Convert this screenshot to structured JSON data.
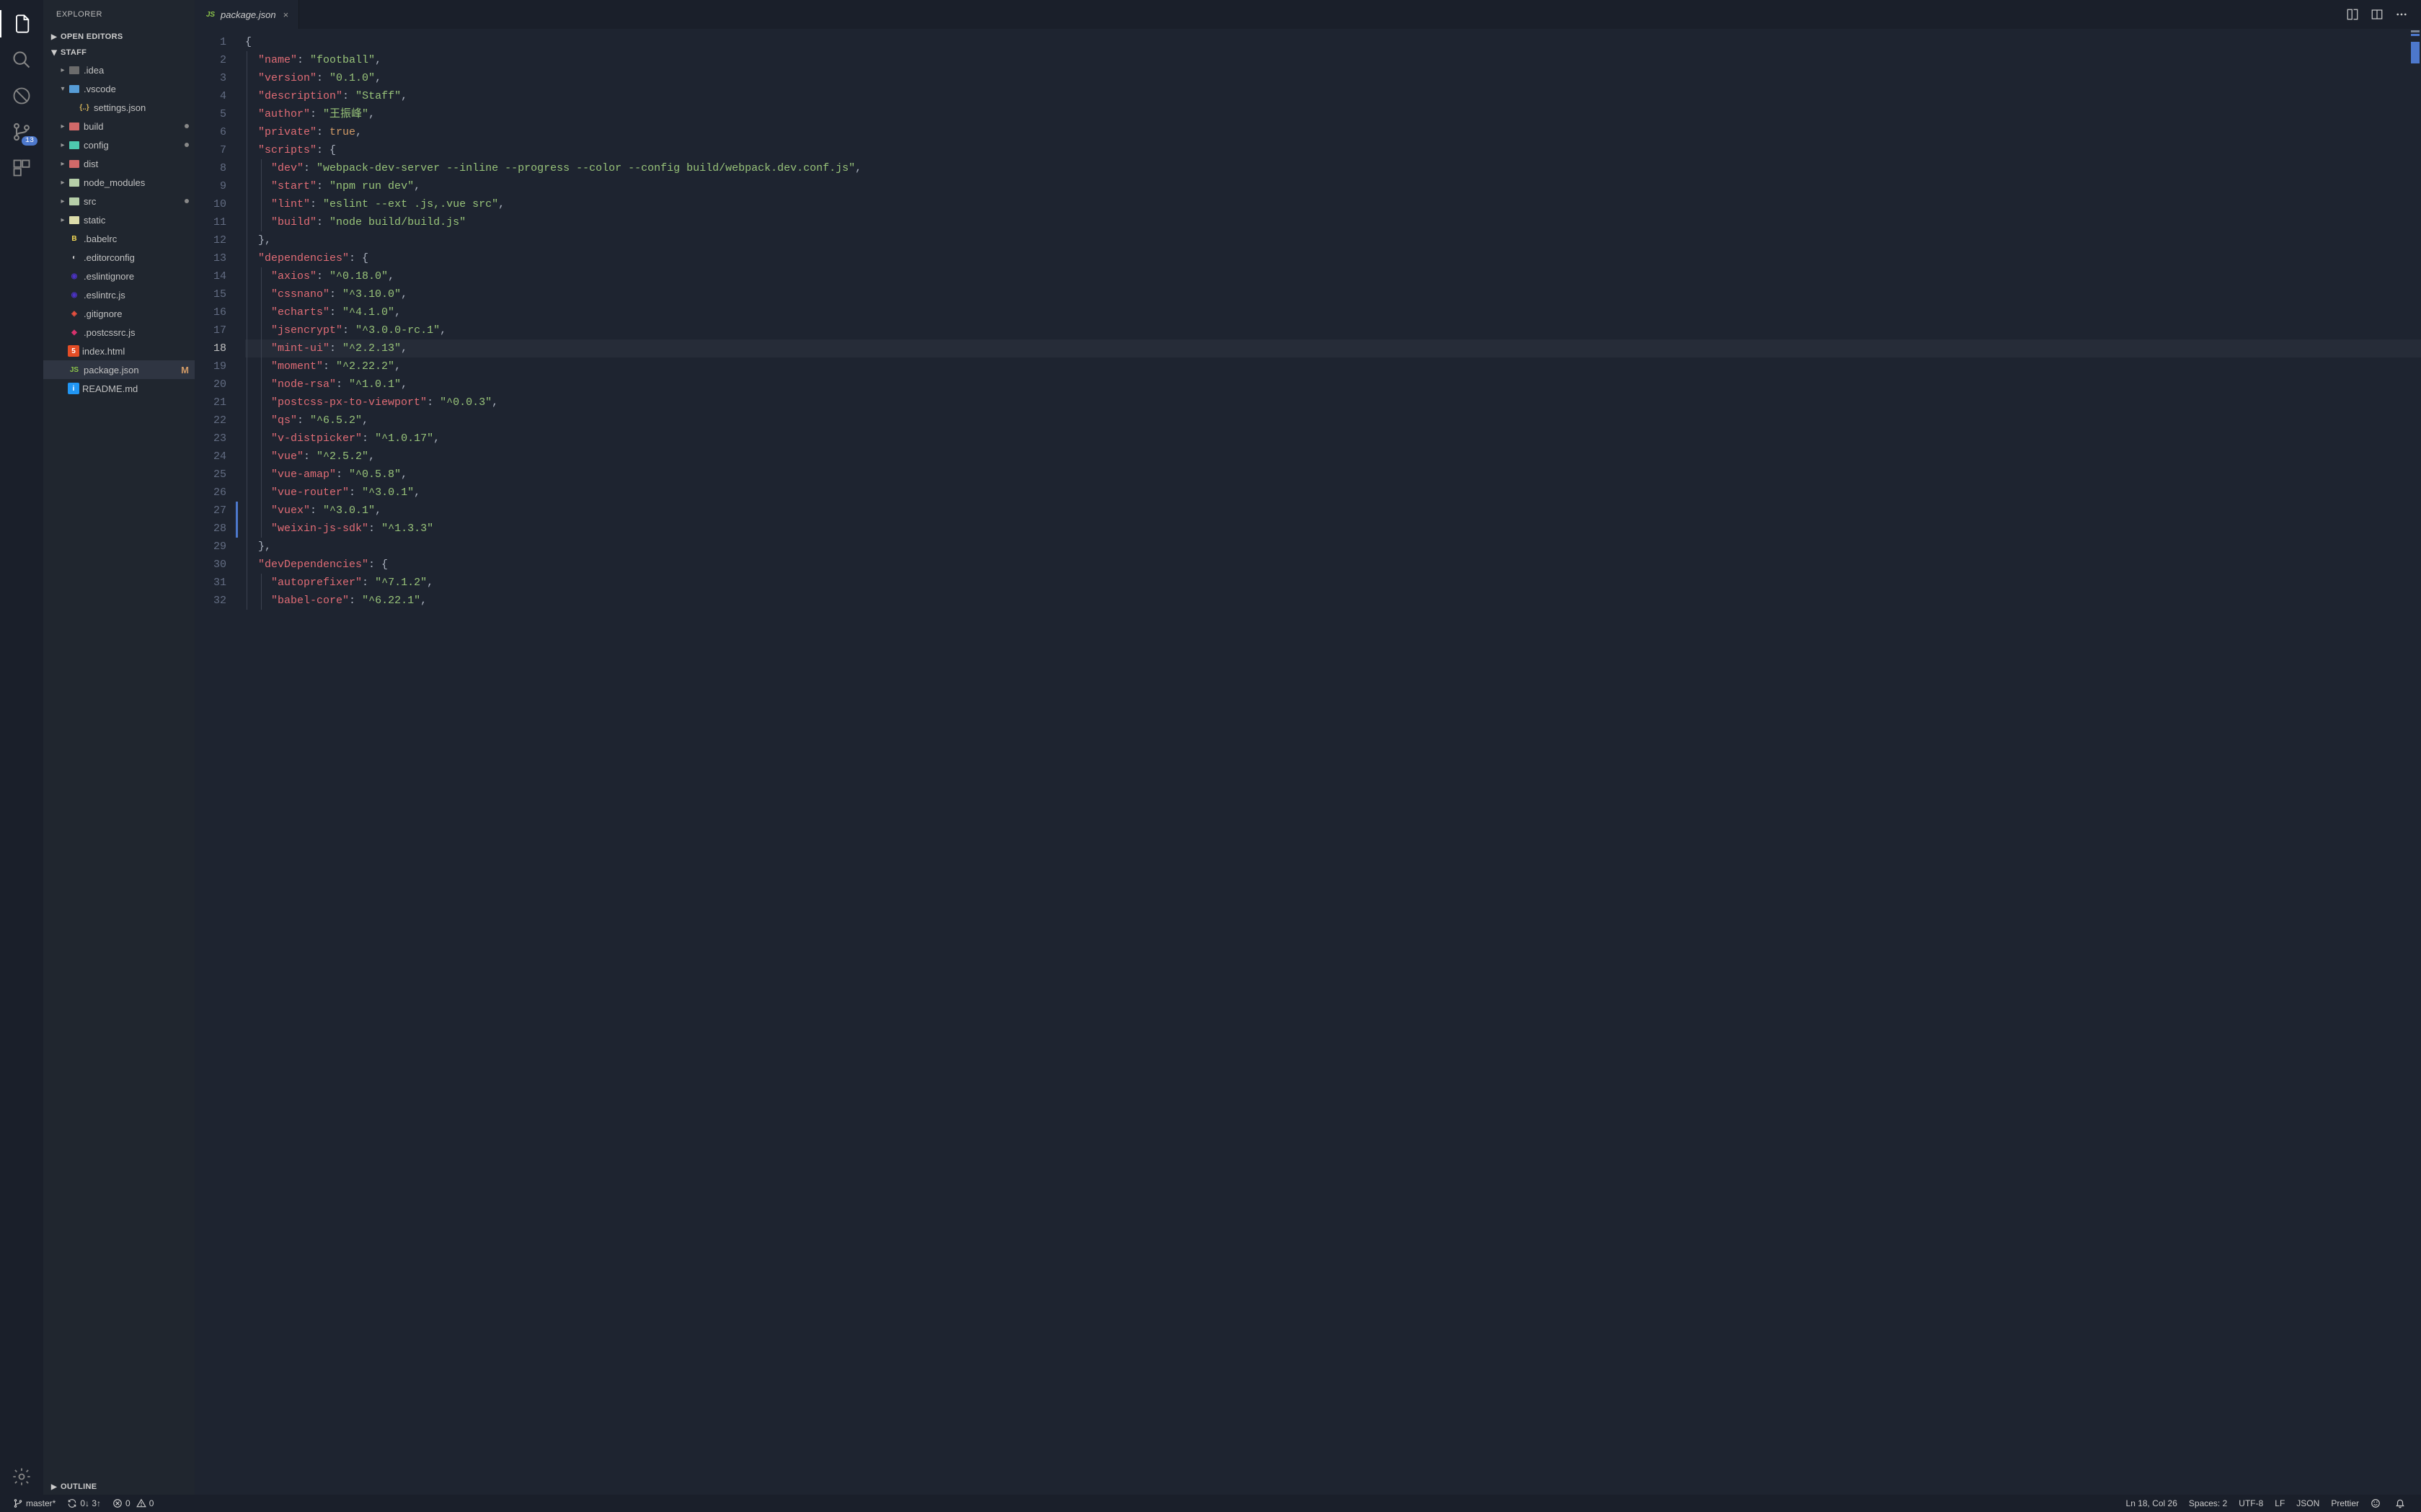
{
  "sidebar": {
    "title": "EXPLORER",
    "sections": {
      "open_editors": "OPEN EDITORS",
      "outline": "OUTLINE"
    },
    "root_name": "STAFF",
    "tree": [
      {
        "name": ".idea",
        "kind": "folder",
        "depth": 1,
        "expanded": false,
        "iconColor": "folder-gray"
      },
      {
        "name": ".vscode",
        "kind": "folder",
        "depth": 1,
        "expanded": true,
        "iconColor": "folder-blue"
      },
      {
        "name": "settings.json",
        "kind": "file",
        "depth": 2,
        "icon": "json"
      },
      {
        "name": "build",
        "kind": "folder",
        "depth": 1,
        "expanded": false,
        "iconColor": "folder-red",
        "dirty": true
      },
      {
        "name": "config",
        "kind": "folder",
        "depth": 1,
        "expanded": false,
        "iconColor": "folder-teal",
        "dirty": true
      },
      {
        "name": "dist",
        "kind": "folder",
        "depth": 1,
        "expanded": false,
        "iconColor": "folder-red"
      },
      {
        "name": "node_modules",
        "kind": "folder",
        "depth": 1,
        "expanded": false,
        "iconColor": "folder-green"
      },
      {
        "name": "src",
        "kind": "folder",
        "depth": 1,
        "expanded": false,
        "iconColor": "folder-green",
        "dirty": true
      },
      {
        "name": "static",
        "kind": "folder",
        "depth": 1,
        "expanded": false,
        "iconColor": "folder-yellow"
      },
      {
        "name": ".babelrc",
        "kind": "file",
        "depth": 1,
        "icon": "babel"
      },
      {
        "name": ".editorconfig",
        "kind": "file",
        "depth": 1,
        "icon": "editorconfig"
      },
      {
        "name": ".eslintignore",
        "kind": "file",
        "depth": 1,
        "icon": "eslint"
      },
      {
        "name": ".eslintrc.js",
        "kind": "file",
        "depth": 1,
        "icon": "eslint"
      },
      {
        "name": ".gitignore",
        "kind": "file",
        "depth": 1,
        "icon": "git"
      },
      {
        "name": ".postcssrc.js",
        "kind": "file",
        "depth": 1,
        "icon": "postcss"
      },
      {
        "name": "index.html",
        "kind": "file",
        "depth": 1,
        "icon": "html"
      },
      {
        "name": "package.json",
        "kind": "file",
        "depth": 1,
        "icon": "npm",
        "selected": true,
        "badge": "M"
      },
      {
        "name": "README.md",
        "kind": "file",
        "depth": 1,
        "icon": "info"
      }
    ]
  },
  "activity_bar": {
    "items": [
      {
        "id": "explorer",
        "active": true
      },
      {
        "id": "search"
      },
      {
        "id": "debug-disabled"
      },
      {
        "id": "scm",
        "badge": "13"
      },
      {
        "id": "extensions"
      }
    ],
    "bottom": [
      {
        "id": "settings"
      }
    ]
  },
  "tabs": [
    {
      "label": "package.json",
      "icon": "npm",
      "active": true,
      "dirty": false
    }
  ],
  "editor": {
    "current_line": 18,
    "diff_markers": [
      {
        "line": 27,
        "color": "#4d78cc"
      },
      {
        "line": 28,
        "color": "#4d78cc"
      }
    ],
    "lines": [
      [
        {
          "t": "{",
          "c": "c-punct"
        }
      ],
      [
        {
          "t": "  ",
          "c": ""
        },
        {
          "t": "\"name\"",
          "c": "c-keyr"
        },
        {
          "t": ": ",
          "c": "c-punct"
        },
        {
          "t": "\"football\"",
          "c": "c-str"
        },
        {
          "t": ",",
          "c": "c-punct"
        }
      ],
      [
        {
          "t": "  ",
          "c": ""
        },
        {
          "t": "\"version\"",
          "c": "c-keyr"
        },
        {
          "t": ": ",
          "c": "c-punct"
        },
        {
          "t": "\"0.1.0\"",
          "c": "c-str"
        },
        {
          "t": ",",
          "c": "c-punct"
        }
      ],
      [
        {
          "t": "  ",
          "c": ""
        },
        {
          "t": "\"description\"",
          "c": "c-keyr"
        },
        {
          "t": ": ",
          "c": "c-punct"
        },
        {
          "t": "\"Staff\"",
          "c": "c-str"
        },
        {
          "t": ",",
          "c": "c-punct"
        }
      ],
      [
        {
          "t": "  ",
          "c": ""
        },
        {
          "t": "\"author\"",
          "c": "c-keyr"
        },
        {
          "t": ": ",
          "c": "c-punct"
        },
        {
          "t": "\"王振峰\"",
          "c": "c-str"
        },
        {
          "t": ",",
          "c": "c-punct"
        }
      ],
      [
        {
          "t": "  ",
          "c": ""
        },
        {
          "t": "\"private\"",
          "c": "c-keyr"
        },
        {
          "t": ": ",
          "c": "c-punct"
        },
        {
          "t": "true",
          "c": "c-const"
        },
        {
          "t": ",",
          "c": "c-punct"
        }
      ],
      [
        {
          "t": "  ",
          "c": ""
        },
        {
          "t": "\"scripts\"",
          "c": "c-keyr"
        },
        {
          "t": ": {",
          "c": "c-punct"
        }
      ],
      [
        {
          "t": "    ",
          "c": ""
        },
        {
          "t": "\"dev\"",
          "c": "c-keyr"
        },
        {
          "t": ": ",
          "c": "c-punct"
        },
        {
          "t": "\"webpack-dev-server --inline --progress --color --config build/webpack.dev.conf.js\"",
          "c": "c-str"
        },
        {
          "t": ",",
          "c": "c-punct"
        }
      ],
      [
        {
          "t": "    ",
          "c": ""
        },
        {
          "t": "\"start\"",
          "c": "c-keyr"
        },
        {
          "t": ": ",
          "c": "c-punct"
        },
        {
          "t": "\"npm run dev\"",
          "c": "c-str"
        },
        {
          "t": ",",
          "c": "c-punct"
        }
      ],
      [
        {
          "t": "    ",
          "c": ""
        },
        {
          "t": "\"lint\"",
          "c": "c-keyr"
        },
        {
          "t": ": ",
          "c": "c-punct"
        },
        {
          "t": "\"eslint --ext .js,.vue src\"",
          "c": "c-str"
        },
        {
          "t": ",",
          "c": "c-punct"
        }
      ],
      [
        {
          "t": "    ",
          "c": ""
        },
        {
          "t": "\"build\"",
          "c": "c-keyr"
        },
        {
          "t": ": ",
          "c": "c-punct"
        },
        {
          "t": "\"node build/build.js\"",
          "c": "c-str"
        }
      ],
      [
        {
          "t": "  ",
          "c": ""
        },
        {
          "t": "},",
          "c": "c-punct"
        }
      ],
      [
        {
          "t": "  ",
          "c": ""
        },
        {
          "t": "\"dependencies\"",
          "c": "c-keyr"
        },
        {
          "t": ": {",
          "c": "c-punct"
        }
      ],
      [
        {
          "t": "    ",
          "c": ""
        },
        {
          "t": "\"axios\"",
          "c": "c-keyr"
        },
        {
          "t": ": ",
          "c": "c-punct"
        },
        {
          "t": "\"^0.18.0\"",
          "c": "c-str"
        },
        {
          "t": ",",
          "c": "c-punct"
        }
      ],
      [
        {
          "t": "    ",
          "c": ""
        },
        {
          "t": "\"cssnano\"",
          "c": "c-keyr"
        },
        {
          "t": ": ",
          "c": "c-punct"
        },
        {
          "t": "\"^3.10.0\"",
          "c": "c-str"
        },
        {
          "t": ",",
          "c": "c-punct"
        }
      ],
      [
        {
          "t": "    ",
          "c": ""
        },
        {
          "t": "\"echarts\"",
          "c": "c-keyr"
        },
        {
          "t": ": ",
          "c": "c-punct"
        },
        {
          "t": "\"^4.1.0\"",
          "c": "c-str"
        },
        {
          "t": ",",
          "c": "c-punct"
        }
      ],
      [
        {
          "t": "    ",
          "c": ""
        },
        {
          "t": "\"jsencrypt\"",
          "c": "c-keyr"
        },
        {
          "t": ": ",
          "c": "c-punct"
        },
        {
          "t": "\"^3.0.0-rc.1\"",
          "c": "c-str"
        },
        {
          "t": ",",
          "c": "c-punct"
        }
      ],
      [
        {
          "t": "    ",
          "c": ""
        },
        {
          "t": "\"mint-ui\"",
          "c": "c-keyr"
        },
        {
          "t": ": ",
          "c": "c-punct"
        },
        {
          "t": "\"^2.2.13\"",
          "c": "c-str"
        },
        {
          "t": ",",
          "c": "c-punct"
        }
      ],
      [
        {
          "t": "    ",
          "c": ""
        },
        {
          "t": "\"moment\"",
          "c": "c-keyr"
        },
        {
          "t": ": ",
          "c": "c-punct"
        },
        {
          "t": "\"^2.22.2\"",
          "c": "c-str"
        },
        {
          "t": ",",
          "c": "c-punct"
        }
      ],
      [
        {
          "t": "    ",
          "c": ""
        },
        {
          "t": "\"node-rsa\"",
          "c": "c-keyr"
        },
        {
          "t": ": ",
          "c": "c-punct"
        },
        {
          "t": "\"^1.0.1\"",
          "c": "c-str"
        },
        {
          "t": ",",
          "c": "c-punct"
        }
      ],
      [
        {
          "t": "    ",
          "c": ""
        },
        {
          "t": "\"postcss-px-to-viewport\"",
          "c": "c-keyr"
        },
        {
          "t": ": ",
          "c": "c-punct"
        },
        {
          "t": "\"^0.0.3\"",
          "c": "c-str"
        },
        {
          "t": ",",
          "c": "c-punct"
        }
      ],
      [
        {
          "t": "    ",
          "c": ""
        },
        {
          "t": "\"qs\"",
          "c": "c-keyr"
        },
        {
          "t": ": ",
          "c": "c-punct"
        },
        {
          "t": "\"^6.5.2\"",
          "c": "c-str"
        },
        {
          "t": ",",
          "c": "c-punct"
        }
      ],
      [
        {
          "t": "    ",
          "c": ""
        },
        {
          "t": "\"v-distpicker\"",
          "c": "c-keyr"
        },
        {
          "t": ": ",
          "c": "c-punct"
        },
        {
          "t": "\"^1.0.17\"",
          "c": "c-str"
        },
        {
          "t": ",",
          "c": "c-punct"
        }
      ],
      [
        {
          "t": "    ",
          "c": ""
        },
        {
          "t": "\"vue\"",
          "c": "c-keyr"
        },
        {
          "t": ": ",
          "c": "c-punct"
        },
        {
          "t": "\"^2.5.2\"",
          "c": "c-str"
        },
        {
          "t": ",",
          "c": "c-punct"
        }
      ],
      [
        {
          "t": "    ",
          "c": ""
        },
        {
          "t": "\"vue-amap\"",
          "c": "c-keyr"
        },
        {
          "t": ": ",
          "c": "c-punct"
        },
        {
          "t": "\"^0.5.8\"",
          "c": "c-str"
        },
        {
          "t": ",",
          "c": "c-punct"
        }
      ],
      [
        {
          "t": "    ",
          "c": ""
        },
        {
          "t": "\"vue-router\"",
          "c": "c-keyr"
        },
        {
          "t": ": ",
          "c": "c-punct"
        },
        {
          "t": "\"^3.0.1\"",
          "c": "c-str"
        },
        {
          "t": ",",
          "c": "c-punct"
        }
      ],
      [
        {
          "t": "    ",
          "c": ""
        },
        {
          "t": "\"vuex\"",
          "c": "c-keyr"
        },
        {
          "t": ": ",
          "c": "c-punct"
        },
        {
          "t": "\"^3.0.1\"",
          "c": "c-str"
        },
        {
          "t": ",",
          "c": "c-punct"
        }
      ],
      [
        {
          "t": "    ",
          "c": ""
        },
        {
          "t": "\"weixin-js-sdk\"",
          "c": "c-keyr"
        },
        {
          "t": ": ",
          "c": "c-punct"
        },
        {
          "t": "\"^1.3.3\"",
          "c": "c-str"
        }
      ],
      [
        {
          "t": "  ",
          "c": ""
        },
        {
          "t": "},",
          "c": "c-punct"
        }
      ],
      [
        {
          "t": "  ",
          "c": ""
        },
        {
          "t": "\"devDependencies\"",
          "c": "c-keyr"
        },
        {
          "t": ": {",
          "c": "c-punct"
        }
      ],
      [
        {
          "t": "    ",
          "c": ""
        },
        {
          "t": "\"autoprefixer\"",
          "c": "c-keyr"
        },
        {
          "t": ": ",
          "c": "c-punct"
        },
        {
          "t": "\"^7.1.2\"",
          "c": "c-str"
        },
        {
          "t": ",",
          "c": "c-punct"
        }
      ],
      [
        {
          "t": "    ",
          "c": ""
        },
        {
          "t": "\"babel-core\"",
          "c": "c-keyr"
        },
        {
          "t": ": ",
          "c": "c-punct"
        },
        {
          "t": "\"^6.22.1\"",
          "c": "c-str"
        },
        {
          "t": ",",
          "c": "c-punct"
        }
      ]
    ]
  },
  "status_bar": {
    "branch": "master*",
    "sync": "0↓ 3↑",
    "errors": "0",
    "warnings": "0",
    "cursor": "Ln 18, Col 26",
    "indent": "Spaces: 2",
    "encoding": "UTF-8",
    "eol": "LF",
    "language": "JSON",
    "formatter": "Prettier"
  },
  "file_icons": {
    "json": {
      "glyph": "{..}",
      "color": "#d4b35a",
      "bg": ""
    },
    "babel": {
      "glyph": "B",
      "color": "#f5da55",
      "bg": ""
    },
    "editorconfig": {
      "glyph": "◐",
      "color": "#ccc",
      "bg": ""
    },
    "eslint": {
      "glyph": "◉",
      "color": "#4b32c3",
      "bg": ""
    },
    "git": {
      "glyph": "◈",
      "color": "#e8503f",
      "bg": ""
    },
    "postcss": {
      "glyph": "◆",
      "color": "#d6326c",
      "bg": ""
    },
    "html": {
      "glyph": "5",
      "color": "#fff",
      "bg": "#e44d26"
    },
    "npm": {
      "glyph": "JS",
      "color": "#8bc34a",
      "bg": ""
    },
    "info": {
      "glyph": "i",
      "color": "#fff",
      "bg": "#2196f3"
    }
  }
}
